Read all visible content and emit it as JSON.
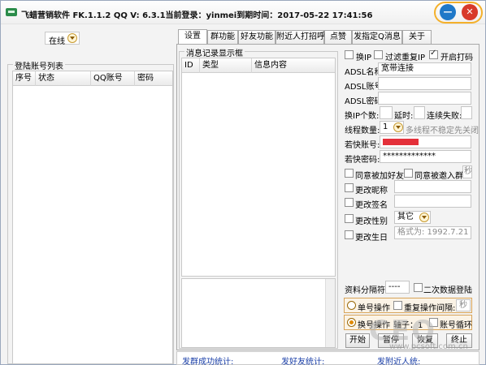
{
  "window": {
    "title": "飞蜡营销软件 FK.1.1.2 QQ V: 6.3.1当前登录：yinmei到期时间：2017-05-22 17:41:56",
    "controls": [
      "—",
      "✕"
    ]
  },
  "left": {
    "status_value": "在线",
    "account_list_title": "登陆账号列表",
    "columns": [
      "序号",
      "状态",
      "QQ账号",
      "密码"
    ]
  },
  "tabs": [
    "设置",
    "群功能",
    "好友功能",
    "附近人打招呼",
    "点赞",
    "发指定Q消息",
    "关于"
  ],
  "message_log": {
    "title": "消息记录显示框",
    "columns": [
      "ID",
      "类型",
      "信息内容"
    ]
  },
  "settings": {
    "switch_ip": "换IP",
    "filter_dup_ip": "过滤重复IP",
    "enable_coding": "开启打码",
    "adsl_name_label": "ADSL名称:",
    "adsl_name_value": "宽带连接",
    "adsl_account_label": "ADSL账号:",
    "adsl_password_label": "ADSL密码:",
    "ip_count_label": "换IP个数:",
    "delay_label": "延时:",
    "fail_label": "连续失败:",
    "threads_label": "线程数量:",
    "threads_value": "1",
    "threads_hint": "多线程不稳定先关闭",
    "ruokuai_account_label": "若快账号:",
    "ruokuai_password_label": "若快密码:",
    "ruokuai_password_value": "*************",
    "accept_friend": "同意被加好友",
    "accept_group": "同意被邀入群",
    "sec_unit": "秒",
    "change_nick": "更改昵称",
    "change_sign": "更改签名",
    "change_gender": "更改性别",
    "gender_value": "其它",
    "change_birthday": "更改生日",
    "birthday_placeholder": "格式为: 1992.7.21",
    "separator_label": "资料分隔符:",
    "separator_value": "----",
    "secondary_login": "二次数据登陆",
    "single_op": "单号操作",
    "repeat_interval": "重复操作间隔:",
    "interval_unit": "秒",
    "switch_op": "换号操作",
    "count_label": "轴子：1",
    "account_loop": "账号循环",
    "start_btn": "开始",
    "pause_btn": "暂停",
    "resume_btn": "恢复",
    "stop_btn": "终止"
  },
  "stats": {
    "group_success": "发群成功统计:",
    "friend_stat": "发好友统计:",
    "nearby_stat": "发附近人统:"
  },
  "watermark": {
    "text": "CEO",
    "url": "www.pcsoft.com.cn"
  }
}
